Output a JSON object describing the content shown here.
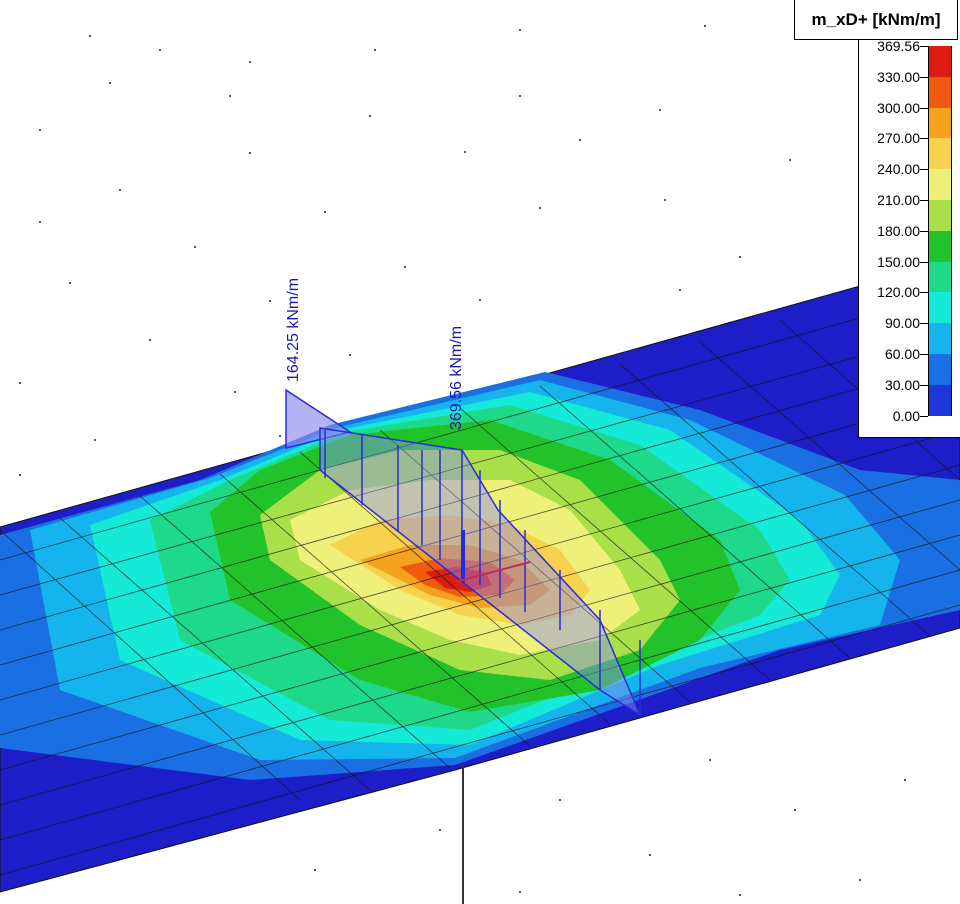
{
  "legend": {
    "title": "m_xD+ [kNm/m]",
    "values": [
      "369.56",
      "330.00",
      "300.00",
      "270.00",
      "240.00",
      "210.00",
      "180.00",
      "150.00",
      "120.00",
      "90.00",
      "60.00",
      "30.00",
      "0.00"
    ],
    "colors": [
      "#dd1c10",
      "#ef5a10",
      "#f5a21c",
      "#f7d24e",
      "#eef07a",
      "#a9e04a",
      "#22c32a",
      "#1fd98a",
      "#15e9d8",
      "#15b4ec",
      "#1a6fe2",
      "#1e38d8"
    ]
  },
  "annotations": {
    "left_value": "164.25 kNm/m",
    "center_value": "369.56 kNm/m"
  },
  "scene_colors": {
    "plate_base": "#1e1ec8",
    "mesh_line": "#1a1a1a",
    "diagram_fill": "#8c8cf0",
    "diagram_line": "#2b2bd6",
    "annotation_text": "#1a1aa8"
  }
}
